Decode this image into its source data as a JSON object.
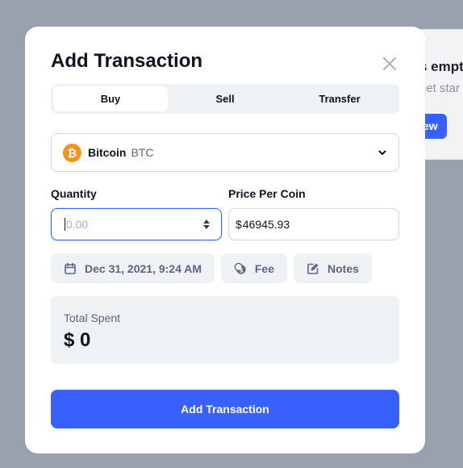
{
  "background": {
    "title_fragment": "s empt",
    "subtitle_fragment": "get star",
    "button_fragment": "ew"
  },
  "modal": {
    "title": "Add Transaction",
    "tabs": [
      {
        "label": "Buy",
        "active": true
      },
      {
        "label": "Sell",
        "active": false
      },
      {
        "label": "Transfer",
        "active": false
      }
    ],
    "coin": {
      "name": "Bitcoin",
      "symbol": "BTC",
      "icon": "bitcoin-icon",
      "color": "#f7931a"
    },
    "quantity": {
      "label": "Quantity",
      "value": "",
      "placeholder": "0.00"
    },
    "price": {
      "label": "Price Per Coin",
      "prefix": "$",
      "value": "46945.93"
    },
    "chips": {
      "date": "Dec 31, 2021, 9:24 AM",
      "fee": "Fee",
      "notes": "Notes"
    },
    "total": {
      "label": "Total Spent",
      "value": "$ 0"
    },
    "submit_label": "Add Transaction"
  },
  "colors": {
    "accent": "#3861fb",
    "overlay": "#9aa1ae",
    "text_primary": "#0d1421",
    "text_secondary": "#58667e"
  }
}
